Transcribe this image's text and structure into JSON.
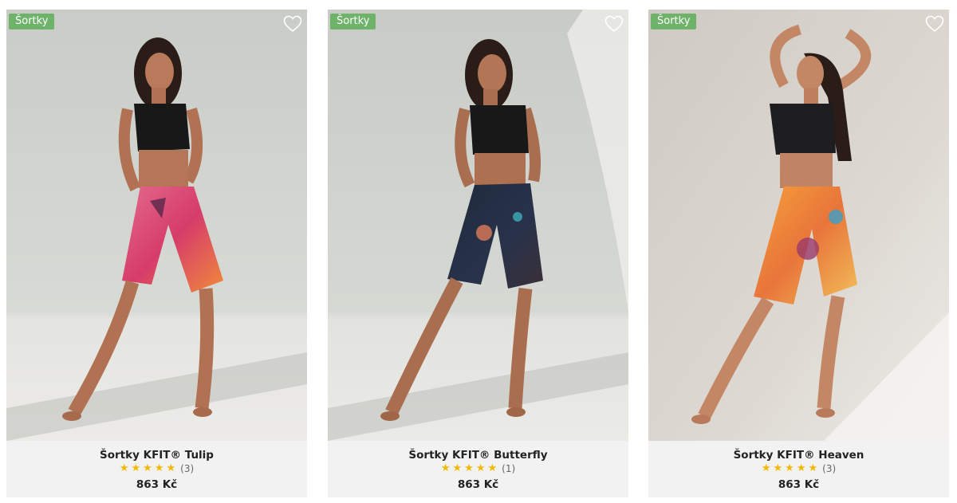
{
  "products": [
    {
      "badge": "Šortky",
      "name": "Šortky KFIT® Tulip",
      "rating_stars": 5,
      "review_count": "(3)",
      "price": "863 Kč",
      "wishlist_icon": "heart-outline-icon",
      "image": "model-in-pink-floral-shorts"
    },
    {
      "badge": "Šortky",
      "name": "Šortky KFIT® Butterfly",
      "rating_stars": 5,
      "review_count": "(1)",
      "price": "863 Kč",
      "wishlist_icon": "heart-outline-icon",
      "image": "model-in-navy-butterfly-shorts"
    },
    {
      "badge": "Šortky",
      "name": "Šortky KFIT® Heaven",
      "rating_stars": 5,
      "review_count": "(3)",
      "price": "863 Kč",
      "wishlist_icon": "heart-outline-icon",
      "image": "model-in-orange-abstract-shorts"
    }
  ],
  "colors": {
    "badge_bg": "#6fb36b",
    "star": "#f5b800",
    "card_bg": "#f2f2f2"
  }
}
